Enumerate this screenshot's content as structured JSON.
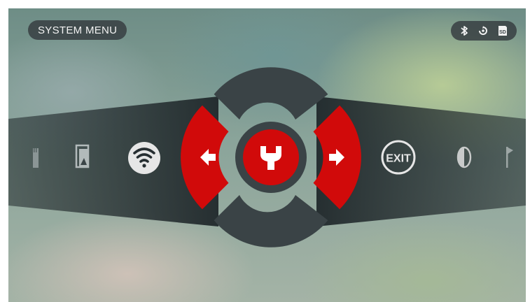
{
  "header": {
    "title": "SYSTEM MENU"
  },
  "status_bar": {
    "icons": [
      "bluetooth-icon",
      "gyroscope-icon",
      "sd-card-icon"
    ],
    "sd_label": "SD"
  },
  "menu_ring": {
    "center_icon": "wrench-icon",
    "left_button_icon": "arrow-left-icon",
    "right_button_icon": "arrow-right-icon",
    "selected_item": "settings"
  },
  "carousel": {
    "left_items": [
      "sd-card-icon",
      "gallery-icon",
      "wifi-icon"
    ],
    "right_items": [
      "exit-icon",
      "contrast-icon",
      "flag-icon"
    ],
    "exit_label": "EXIT"
  },
  "colors": {
    "accent": "#d10a0a",
    "ring_dark": "#3a4346",
    "band": "#262e31",
    "icon_light": "#e6e6e6"
  }
}
